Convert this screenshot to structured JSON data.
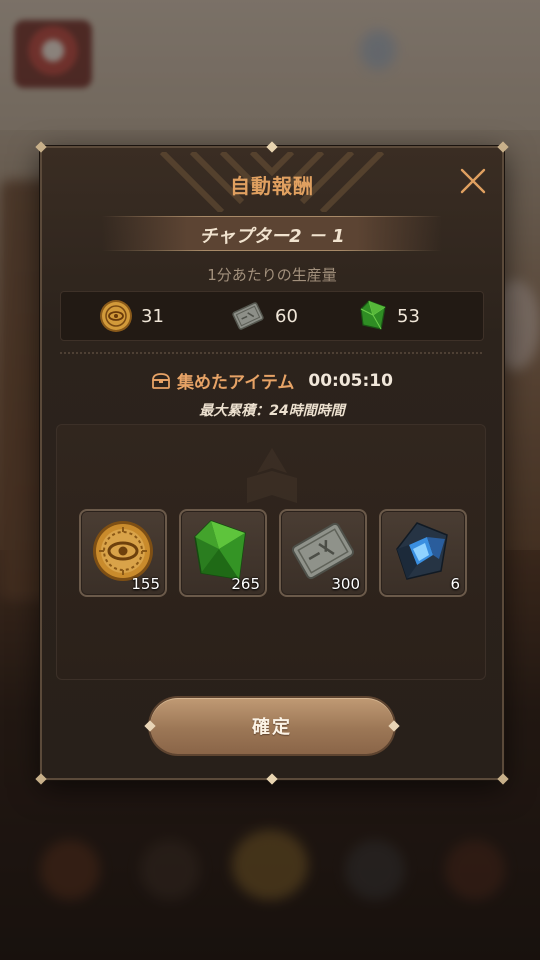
{
  "modal": {
    "title": "自動報酬",
    "chapter": "チャプター2 － 1",
    "rate_label": "1分あたりの生産量",
    "rates": [
      {
        "icon": "gold-coin-icon",
        "value": "31"
      },
      {
        "icon": "stone-tablet-icon",
        "value": "60"
      },
      {
        "icon": "green-crystal-icon",
        "value": "53"
      }
    ],
    "collected_label": "集めたアイテム",
    "collected_time": "00:05:10",
    "max_accumulation": "最大累積：24時間時間",
    "items": [
      {
        "icon": "gold-coin-icon",
        "quantity": "155"
      },
      {
        "icon": "green-crystal-icon",
        "quantity": "265"
      },
      {
        "icon": "stone-tablet-icon",
        "quantity": "300"
      },
      {
        "icon": "blue-crystal-icon",
        "quantity": "6"
      }
    ],
    "confirm_label": "確定"
  },
  "colors": {
    "accent": "#e0a060",
    "panel": "#2c231c",
    "button": "#9c7756"
  }
}
